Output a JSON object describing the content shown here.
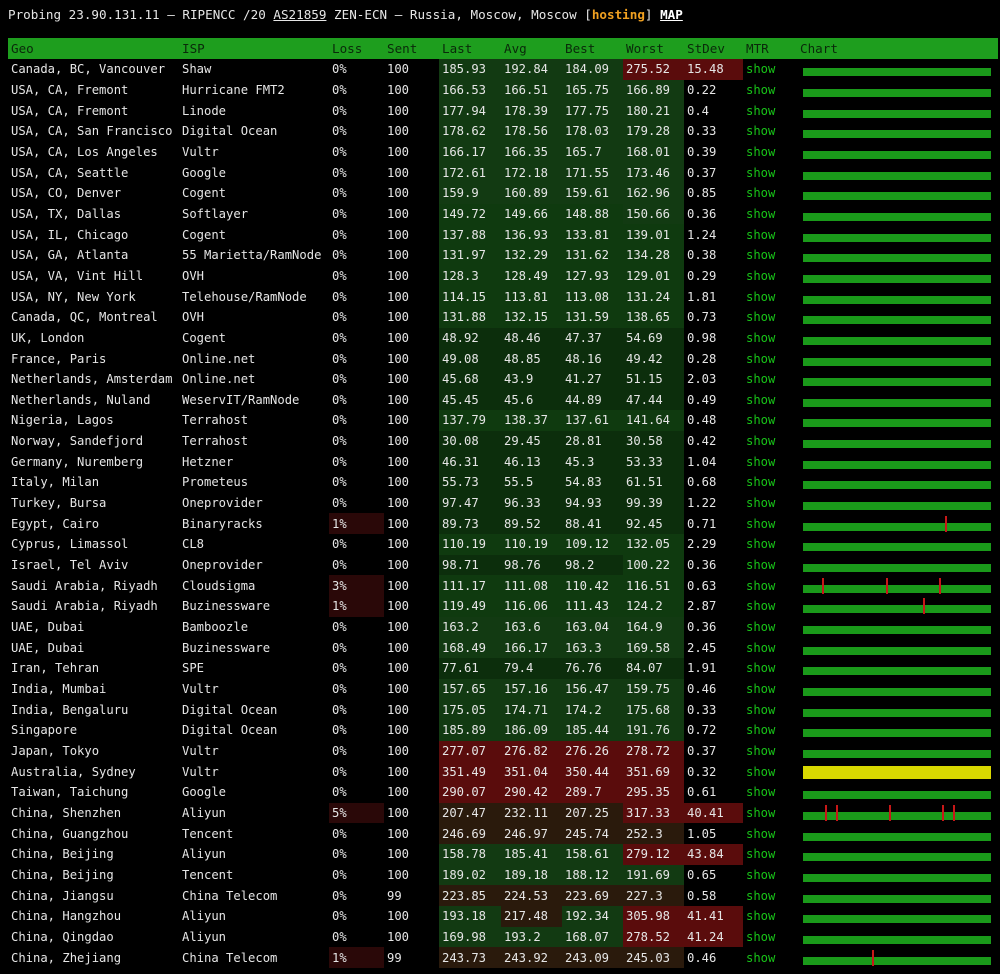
{
  "header": {
    "prefix": "Probing 23.90.131.11 – RIPENCC /20 ",
    "asn": "AS21859",
    "middle": " ZEN-ECN – Russia, Moscow, Moscow [",
    "tag": "hosting",
    "suffix": "] ",
    "map": "MAP"
  },
  "columns": [
    "Geo",
    "ISP",
    "Loss",
    "Sent",
    "Last",
    "Avg",
    "Best",
    "Worst",
    "StDev",
    "MTR",
    "Chart"
  ],
  "colors": {
    "header_bg": "#1e9e1e",
    "link": "#18c418",
    "chart_green": "#1a9a1a",
    "chart_yellow": "#d8d800",
    "spike": "#c81818"
  },
  "rows": [
    {
      "geo": "Canada, BC, Vancouver",
      "isp": "Shaw",
      "loss": "0%",
      "sent": "100",
      "last": "185.93",
      "avg": "192.84",
      "best": "184.09",
      "worst": "275.52",
      "stdev": "15.48",
      "mtr": "show"
    },
    {
      "geo": "USA, CA, Fremont",
      "isp": "Hurricane FMT2",
      "loss": "0%",
      "sent": "100",
      "last": "166.53",
      "avg": "166.51",
      "best": "165.75",
      "worst": "166.89",
      "stdev": "0.22",
      "mtr": "show"
    },
    {
      "geo": "USA, CA, Fremont",
      "isp": "Linode",
      "loss": "0%",
      "sent": "100",
      "last": "177.94",
      "avg": "178.39",
      "best": "177.75",
      "worst": "180.21",
      "stdev": "0.4",
      "mtr": "show"
    },
    {
      "geo": "USA, CA, San Francisco",
      "isp": "Digital Ocean",
      "loss": "0%",
      "sent": "100",
      "last": "178.62",
      "avg": "178.56",
      "best": "178.03",
      "worst": "179.28",
      "stdev": "0.33",
      "mtr": "show"
    },
    {
      "geo": "USA, CA, Los Angeles",
      "isp": "Vultr",
      "loss": "0%",
      "sent": "100",
      "last": "166.17",
      "avg": "166.35",
      "best": "165.7",
      "worst": "168.01",
      "stdev": "0.39",
      "mtr": "show"
    },
    {
      "geo": "USA, CA, Seattle",
      "isp": "Google",
      "loss": "0%",
      "sent": "100",
      "last": "172.61",
      "avg": "172.18",
      "best": "171.55",
      "worst": "173.46",
      "stdev": "0.37",
      "mtr": "show"
    },
    {
      "geo": "USA, CO, Denver",
      "isp": "Cogent",
      "loss": "0%",
      "sent": "100",
      "last": "159.9",
      "avg": "160.89",
      "best": "159.61",
      "worst": "162.96",
      "stdev": "0.85",
      "mtr": "show"
    },
    {
      "geo": "USA, TX, Dallas",
      "isp": "Softlayer",
      "loss": "0%",
      "sent": "100",
      "last": "149.72",
      "avg": "149.66",
      "best": "148.88",
      "worst": "150.66",
      "stdev": "0.36",
      "mtr": "show"
    },
    {
      "geo": "USA, IL, Chicago",
      "isp": "Cogent",
      "loss": "0%",
      "sent": "100",
      "last": "137.88",
      "avg": "136.93",
      "best": "133.81",
      "worst": "139.01",
      "stdev": "1.24",
      "mtr": "show"
    },
    {
      "geo": "USA, GA, Atlanta",
      "isp": "55 Marietta/RamNode",
      "loss": "0%",
      "sent": "100",
      "last": "131.97",
      "avg": "132.29",
      "best": "131.62",
      "worst": "134.28",
      "stdev": "0.38",
      "mtr": "show"
    },
    {
      "geo": "USA, VA, Vint Hill",
      "isp": "OVH",
      "loss": "0%",
      "sent": "100",
      "last": "128.3",
      "avg": "128.49",
      "best": "127.93",
      "worst": "129.01",
      "stdev": "0.29",
      "mtr": "show"
    },
    {
      "geo": "USA, NY, New York",
      "isp": "Telehouse/RamNode",
      "loss": "0%",
      "sent": "100",
      "last": "114.15",
      "avg": "113.81",
      "best": "113.08",
      "worst": "131.24",
      "stdev": "1.81",
      "mtr": "show"
    },
    {
      "geo": "Canada, QC, Montreal",
      "isp": "OVH",
      "loss": "0%",
      "sent": "100",
      "last": "131.88",
      "avg": "132.15",
      "best": "131.59",
      "worst": "138.65",
      "stdev": "0.73",
      "mtr": "show"
    },
    {
      "geo": "UK, London",
      "isp": "Cogent",
      "loss": "0%",
      "sent": "100",
      "last": "48.92",
      "avg": "48.46",
      "best": "47.37",
      "worst": "54.69",
      "stdev": "0.98",
      "mtr": "show"
    },
    {
      "geo": "France, Paris",
      "isp": "Online.net",
      "loss": "0%",
      "sent": "100",
      "last": "49.08",
      "avg": "48.85",
      "best": "48.16",
      "worst": "49.42",
      "stdev": "0.28",
      "mtr": "show"
    },
    {
      "geo": "Netherlands, Amsterdam",
      "isp": "Online.net",
      "loss": "0%",
      "sent": "100",
      "last": "45.68",
      "avg": "43.9",
      "best": "41.27",
      "worst": "51.15",
      "stdev": "2.03",
      "mtr": "show"
    },
    {
      "geo": "Netherlands, Nuland",
      "isp": "WeservIT/RamNode",
      "loss": "0%",
      "sent": "100",
      "last": "45.45",
      "avg": "45.6",
      "best": "44.89",
      "worst": "47.44",
      "stdev": "0.49",
      "mtr": "show"
    },
    {
      "geo": "Nigeria, Lagos",
      "isp": "Terrahost",
      "loss": "0%",
      "sent": "100",
      "last": "137.79",
      "avg": "138.37",
      "best": "137.61",
      "worst": "141.64",
      "stdev": "0.48",
      "mtr": "show"
    },
    {
      "geo": "Norway, Sandefjord",
      "isp": "Terrahost",
      "loss": "0%",
      "sent": "100",
      "last": "30.08",
      "avg": "29.45",
      "best": "28.81",
      "worst": "30.58",
      "stdev": "0.42",
      "mtr": "show"
    },
    {
      "geo": "Germany, Nuremberg",
      "isp": "Hetzner",
      "loss": "0%",
      "sent": "100",
      "last": "46.31",
      "avg": "46.13",
      "best": "45.3",
      "worst": "53.33",
      "stdev": "1.04",
      "mtr": "show"
    },
    {
      "geo": "Italy, Milan",
      "isp": "Prometeus",
      "loss": "0%",
      "sent": "100",
      "last": "55.73",
      "avg": "55.5",
      "best": "54.83",
      "worst": "61.51",
      "stdev": "0.68",
      "mtr": "show"
    },
    {
      "geo": "Turkey, Bursa",
      "isp": "Oneprovider",
      "loss": "0%",
      "sent": "100",
      "last": "97.47",
      "avg": "96.33",
      "best": "94.93",
      "worst": "99.39",
      "stdev": "1.22",
      "mtr": "show"
    },
    {
      "geo": "Egypt, Cairo",
      "isp": "Binaryracks",
      "loss": "1%",
      "sent": "100",
      "last": "89.73",
      "avg": "89.52",
      "best": "88.41",
      "worst": "92.45",
      "stdev": "0.71",
      "mtr": "show"
    },
    {
      "geo": "Cyprus, Limassol",
      "isp": "CL8",
      "loss": "0%",
      "sent": "100",
      "last": "110.19",
      "avg": "110.19",
      "best": "109.12",
      "worst": "132.05",
      "stdev": "2.29",
      "mtr": "show"
    },
    {
      "geo": "Israel, Tel Aviv",
      "isp": "Oneprovider",
      "loss": "0%",
      "sent": "100",
      "last": "98.71",
      "avg": "98.76",
      "best": "98.2",
      "worst": "100.22",
      "stdev": "0.36",
      "mtr": "show"
    },
    {
      "geo": "Saudi Arabia, Riyadh",
      "isp": "Cloudsigma",
      "loss": "3%",
      "sent": "100",
      "last": "111.17",
      "avg": "111.08",
      "best": "110.42",
      "worst": "116.51",
      "stdev": "0.63",
      "mtr": "show"
    },
    {
      "geo": "Saudi Arabia, Riyadh",
      "isp": "Buzinessware",
      "loss": "1%",
      "sent": "100",
      "last": "119.49",
      "avg": "116.06",
      "best": "111.43",
      "worst": "124.2",
      "stdev": "2.87",
      "mtr": "show"
    },
    {
      "geo": "UAE, Dubai",
      "isp": "Bamboozle",
      "loss": "0%",
      "sent": "100",
      "last": "163.2",
      "avg": "163.6",
      "best": "163.04",
      "worst": "164.9",
      "stdev": "0.36",
      "mtr": "show"
    },
    {
      "geo": "UAE, Dubai",
      "isp": "Buzinessware",
      "loss": "0%",
      "sent": "100",
      "last": "168.49",
      "avg": "166.17",
      "best": "163.3",
      "worst": "169.58",
      "stdev": "2.45",
      "mtr": "show"
    },
    {
      "geo": "Iran, Tehran",
      "isp": "SPE",
      "loss": "0%",
      "sent": "100",
      "last": "77.61",
      "avg": "79.4",
      "best": "76.76",
      "worst": "84.07",
      "stdev": "1.91",
      "mtr": "show"
    },
    {
      "geo": "India, Mumbai",
      "isp": "Vultr",
      "loss": "0%",
      "sent": "100",
      "last": "157.65",
      "avg": "157.16",
      "best": "156.47",
      "worst": "159.75",
      "stdev": "0.46",
      "mtr": "show"
    },
    {
      "geo": "India, Bengaluru",
      "isp": "Digital Ocean",
      "loss": "0%",
      "sent": "100",
      "last": "175.05",
      "avg": "174.71",
      "best": "174.2",
      "worst": "175.68",
      "stdev": "0.33",
      "mtr": "show"
    },
    {
      "geo": "Singapore",
      "isp": "Digital Ocean",
      "loss": "0%",
      "sent": "100",
      "last": "185.89",
      "avg": "186.09",
      "best": "185.44",
      "worst": "191.76",
      "stdev": "0.72",
      "mtr": "show"
    },
    {
      "geo": "Japan, Tokyo",
      "isp": "Vultr",
      "loss": "0%",
      "sent": "100",
      "last": "277.07",
      "avg": "276.82",
      "best": "276.26",
      "worst": "278.72",
      "stdev": "0.37",
      "mtr": "show"
    },
    {
      "geo": "Australia, Sydney",
      "isp": "Vultr",
      "loss": "0%",
      "sent": "100",
      "last": "351.49",
      "avg": "351.04",
      "best": "350.44",
      "worst": "351.69",
      "stdev": "0.32",
      "mtr": "show"
    },
    {
      "geo": "Taiwan, Taichung",
      "isp": "Google",
      "loss": "0%",
      "sent": "100",
      "last": "290.07",
      "avg": "290.42",
      "best": "289.7",
      "worst": "295.35",
      "stdev": "0.61",
      "mtr": "show"
    },
    {
      "geo": "China, Shenzhen",
      "isp": "Aliyun",
      "loss": "5%",
      "sent": "100",
      "last": "207.47",
      "avg": "232.11",
      "best": "207.25",
      "worst": "317.33",
      "stdev": "40.41",
      "mtr": "show"
    },
    {
      "geo": "China, Guangzhou",
      "isp": "Tencent",
      "loss": "0%",
      "sent": "100",
      "last": "246.69",
      "avg": "246.97",
      "best": "245.74",
      "worst": "252.3",
      "stdev": "1.05",
      "mtr": "show"
    },
    {
      "geo": "China, Beijing",
      "isp": "Aliyun",
      "loss": "0%",
      "sent": "100",
      "last": "158.78",
      "avg": "185.41",
      "best": "158.61",
      "worst": "279.12",
      "stdev": "43.84",
      "mtr": "show"
    },
    {
      "geo": "China, Beijing",
      "isp": "Tencent",
      "loss": "0%",
      "sent": "100",
      "last": "189.02",
      "avg": "189.18",
      "best": "188.12",
      "worst": "191.69",
      "stdev": "0.65",
      "mtr": "show"
    },
    {
      "geo": "China, Jiangsu",
      "isp": "China Telecom",
      "loss": "0%",
      "sent": "99",
      "last": "223.85",
      "avg": "224.53",
      "best": "223.69",
      "worst": "227.3",
      "stdev": "0.58",
      "mtr": "show"
    },
    {
      "geo": "China, Hangzhou",
      "isp": "Aliyun",
      "loss": "0%",
      "sent": "100",
      "last": "193.18",
      "avg": "217.48",
      "best": "192.34",
      "worst": "305.98",
      "stdev": "41.41",
      "mtr": "show"
    },
    {
      "geo": "China, Qingdao",
      "isp": "Aliyun",
      "loss": "0%",
      "sent": "100",
      "last": "169.98",
      "avg": "193.2",
      "best": "168.07",
      "worst": "278.52",
      "stdev": "41.24",
      "mtr": "show"
    },
    {
      "geo": "China, Zhejiang",
      "isp": "China Telecom",
      "loss": "1%",
      "sent": "99",
      "last": "243.73",
      "avg": "243.92",
      "best": "243.09",
      "worst": "245.03",
      "stdev": "0.46",
      "mtr": "show"
    }
  ]
}
